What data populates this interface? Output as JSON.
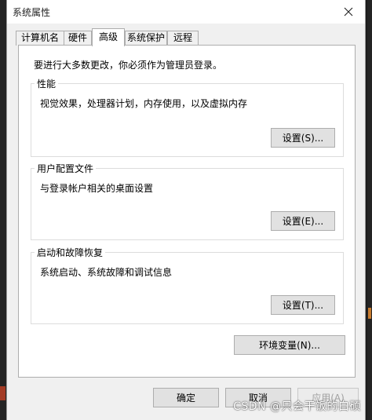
{
  "window": {
    "title": "系统属性"
  },
  "tabs": [
    {
      "label": "计算机名",
      "active": false
    },
    {
      "label": "硬件",
      "active": false
    },
    {
      "label": "高级",
      "active": true
    },
    {
      "label": "系统保护",
      "active": false
    },
    {
      "label": "远程",
      "active": false
    }
  ],
  "notice": "要进行大多数更改，你必须作为管理员登录。",
  "groups": {
    "performance": {
      "title": "性能",
      "description": "视觉效果，处理器计划，内存使用，以及虚拟内存",
      "button": "设置(S)..."
    },
    "user_profiles": {
      "title": "用户配置文件",
      "description": "与登录帐户相关的桌面设置",
      "button": "设置(E)..."
    },
    "startup_recovery": {
      "title": "启动和故障恢复",
      "description": "系统启动、系统故障和调试信息",
      "button": "设置(T)..."
    }
  },
  "env_button": "环境变量(N)...",
  "footer": {
    "ok": "确定",
    "cancel": "取消",
    "apply": "应用(A)"
  },
  "watermark": "CSDN @只会干饭的白硕"
}
